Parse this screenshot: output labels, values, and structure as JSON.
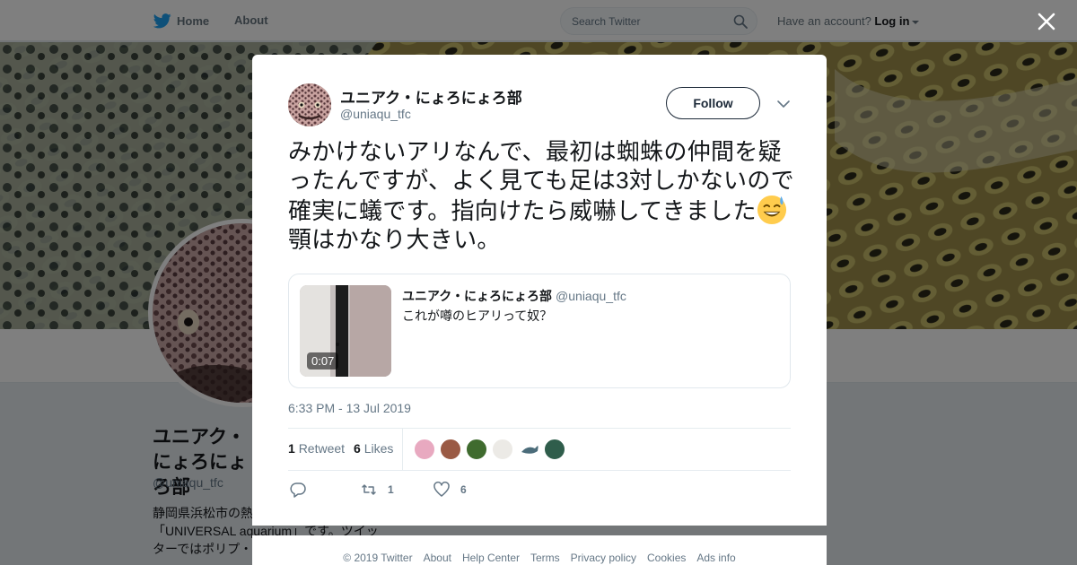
{
  "topbar": {
    "home_label": "Home",
    "about_label": "About",
    "search_placeholder": "Search Twitter",
    "account_prompt": "Have an account?",
    "login_label": "Log in"
  },
  "profile": {
    "name": "ユニアク・にょろにょろ部",
    "handle": "@uniaqu_tfc",
    "bio": "静岡県浜松市の熱帯魚・爬虫類店「UNIVERSAL aquarium」です。ツイッターではポリプ・ニョロニョロ系熱帯"
  },
  "tweet": {
    "author_name": "ユニアク・にょろにょろ部",
    "author_handle": "@uniaqu_tfc",
    "follow_label": "Follow",
    "text_before_emoji": "みかけないアリなんで、最初は蜘蛛の仲間を疑ったんですが、よく見ても足は3対しかないので確実に蟻です。指向けたら威嚇してきました",
    "text_after_emoji": "顎はかなり大きい。",
    "timestamp": "6:33 PM - 13 Jul 2019",
    "retweets_count": "1",
    "retweets_label": "Retweet",
    "likes_count": "6",
    "likes_label": "Likes",
    "reply_count": "",
    "action_retweet_count": "1",
    "action_like_count": "6"
  },
  "quoted": {
    "name": "ユニアク・にょろにょろ部",
    "handle": "@uniaqu_tfc",
    "text": "これが噂のヒアリって奴？",
    "video_duration": "0:07"
  },
  "footer": {
    "links": [
      "© 2019 Twitter",
      "About",
      "Help Center",
      "Terms",
      "Privacy policy",
      "Cookies",
      "Ads info"
    ]
  },
  "colors": {
    "accent": "#1da1f2",
    "text_primary": "#14171a",
    "text_secondary": "#657786",
    "overlay": "rgba(0,0,0,0.5)"
  },
  "icons": [
    "twitter-bird-icon",
    "search-icon",
    "close-icon",
    "chevron-down-icon",
    "reply-icon",
    "retweet-icon",
    "like-icon",
    "sweat-smile-emoji"
  ]
}
